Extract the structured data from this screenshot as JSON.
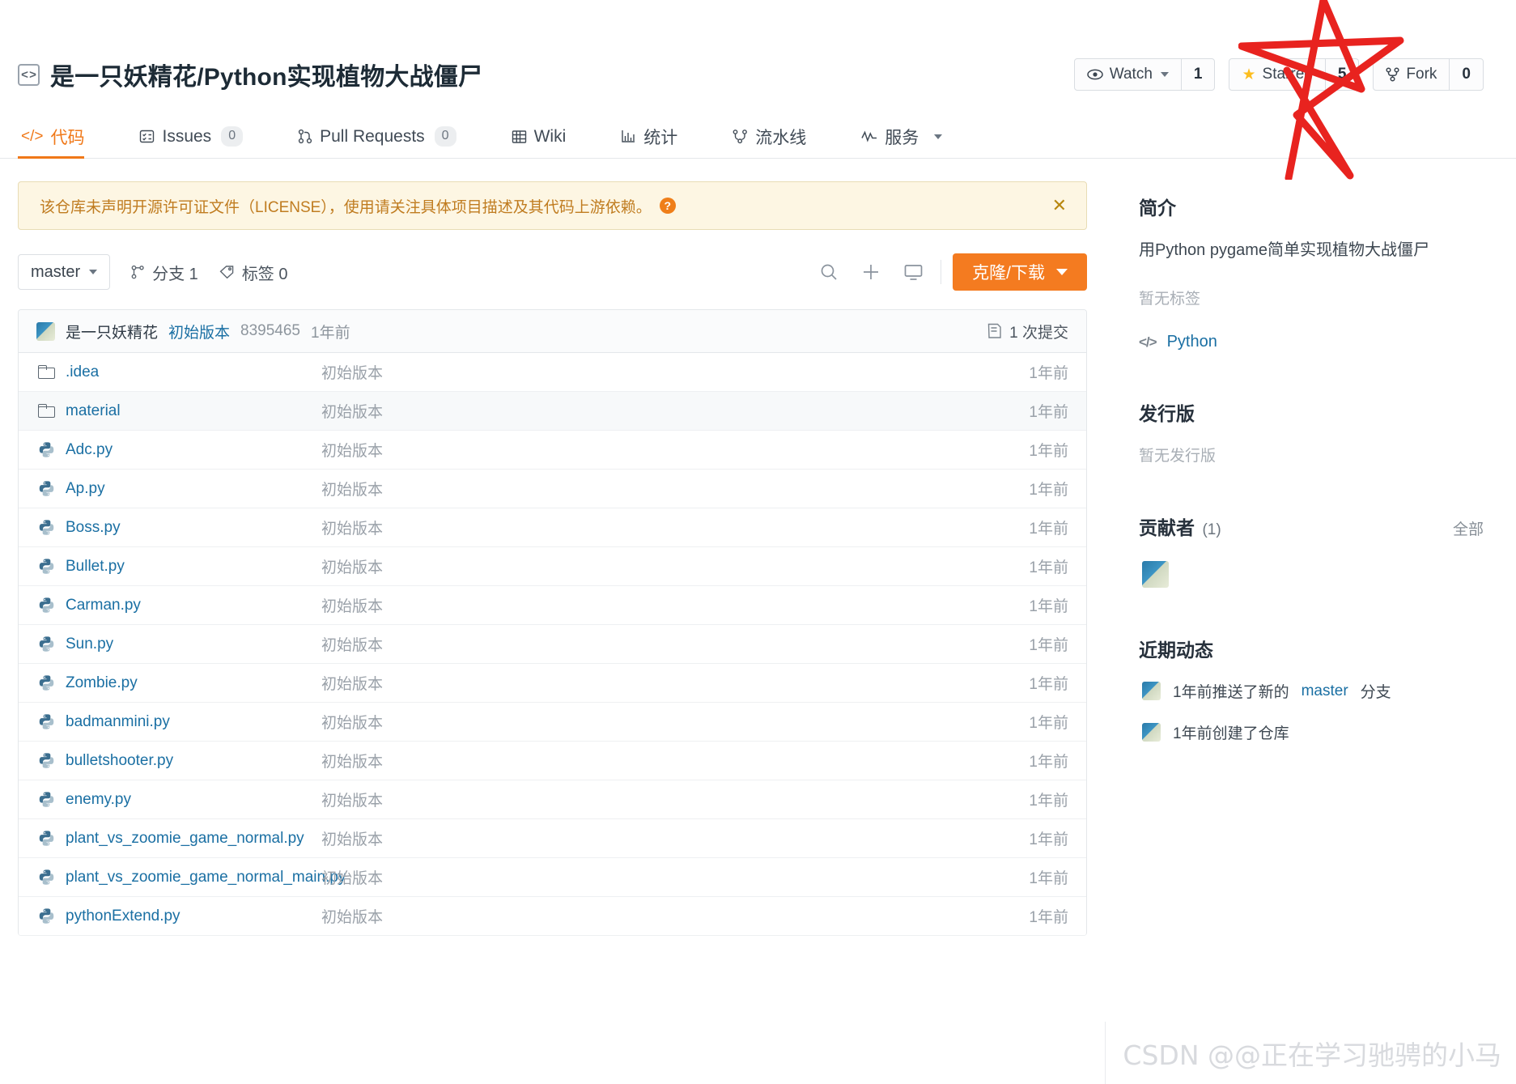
{
  "header": {
    "repo_icon": "code-brackets-icon",
    "repo_name": "是一只妖精花/Python实现植物大战僵尸",
    "actions": [
      {
        "id": "watch",
        "icon": "eye-icon",
        "label": "Watch",
        "has_caret": true,
        "count": "1"
      },
      {
        "id": "star",
        "icon": "star-icon",
        "label": "Starred",
        "has_caret": false,
        "count": "5"
      },
      {
        "id": "fork",
        "icon": "fork-icon",
        "label": "Fork",
        "has_caret": false,
        "count": "0"
      }
    ]
  },
  "nav": {
    "tabs": [
      {
        "id": "code",
        "icon": "code-icon",
        "label": "代码",
        "badge": null,
        "active": true,
        "caret": false
      },
      {
        "id": "issues",
        "icon": "issue-icon",
        "label": "Issues",
        "badge": "0",
        "active": false,
        "caret": false
      },
      {
        "id": "pulls",
        "icon": "pull-request-icon",
        "label": "Pull Requests",
        "badge": "0",
        "active": false,
        "caret": false
      },
      {
        "id": "wiki",
        "icon": "book-icon",
        "label": "Wiki",
        "badge": null,
        "active": false,
        "caret": false
      },
      {
        "id": "stats",
        "icon": "chart-icon",
        "label": "统计",
        "badge": null,
        "active": false,
        "caret": false
      },
      {
        "id": "pipeline",
        "icon": "pipeline-icon",
        "label": "流水线",
        "badge": null,
        "active": false,
        "caret": false
      },
      {
        "id": "service",
        "icon": "activity-icon",
        "label": "服务",
        "badge": null,
        "active": false,
        "caret": true
      }
    ]
  },
  "alert": {
    "text": "该仓库未声明开源许可证文件（LICENSE），使用请关注具体项目描述及其代码上游依赖。",
    "help_icon": "question-mark-icon",
    "close_icon": "close-icon"
  },
  "toolbar": {
    "branch": "master",
    "branch_caret_icon": "chevron-down-icon",
    "branches_icon": "branch-icon",
    "branches_label": "分支 1",
    "tags_icon": "tag-icon",
    "tags_label": "标签 0",
    "icons": [
      {
        "id": "search",
        "name": "search-icon"
      },
      {
        "id": "add",
        "name": "plus-icon"
      },
      {
        "id": "ide",
        "name": "monitor-icon"
      }
    ],
    "clone_label": "克隆/下载"
  },
  "commit_bar": {
    "avatar": "user-avatar",
    "author": "是一只妖精花",
    "message": "初始版本",
    "hash": "8395465",
    "time": "1年前",
    "commits_icon": "commit-icon",
    "commits_label": "1 次提交"
  },
  "files": [
    {
      "type": "folder",
      "name": ".idea",
      "message": "初始版本",
      "time": "1年前",
      "hovered": false
    },
    {
      "type": "folder",
      "name": "material",
      "message": "初始版本",
      "time": "1年前",
      "hovered": true
    },
    {
      "type": "python",
      "name": "Adc.py",
      "message": "初始版本",
      "time": "1年前",
      "hovered": false
    },
    {
      "type": "python",
      "name": "Ap.py",
      "message": "初始版本",
      "time": "1年前",
      "hovered": false
    },
    {
      "type": "python",
      "name": "Boss.py",
      "message": "初始版本",
      "time": "1年前",
      "hovered": false
    },
    {
      "type": "python",
      "name": "Bullet.py",
      "message": "初始版本",
      "time": "1年前",
      "hovered": false
    },
    {
      "type": "python",
      "name": "Carman.py",
      "message": "初始版本",
      "time": "1年前",
      "hovered": false
    },
    {
      "type": "python",
      "name": "Sun.py",
      "message": "初始版本",
      "time": "1年前",
      "hovered": false
    },
    {
      "type": "python",
      "name": "Zombie.py",
      "message": "初始版本",
      "time": "1年前",
      "hovered": false
    },
    {
      "type": "python",
      "name": "badmanmini.py",
      "message": "初始版本",
      "time": "1年前",
      "hovered": false
    },
    {
      "type": "python",
      "name": "bulletshooter.py",
      "message": "初始版本",
      "time": "1年前",
      "hovered": false
    },
    {
      "type": "python",
      "name": "enemy.py",
      "message": "初始版本",
      "time": "1年前",
      "hovered": false
    },
    {
      "type": "python",
      "name": "plant_vs_zoomie_game_normal.py",
      "message": "初始版本",
      "time": "1年前",
      "hovered": false
    },
    {
      "type": "python",
      "name": "plant_vs_zoomie_game_normal_main.py",
      "message": "初始版本",
      "time": "1年前",
      "hovered": false
    },
    {
      "type": "python",
      "name": "pythonExtend.py",
      "message": "初始版本",
      "time": "1年前",
      "hovered": false
    }
  ],
  "sidebar": {
    "intro_title": "简介",
    "intro_desc": "用Python pygame简单实现植物大战僵尸",
    "no_tags": "暂无标签",
    "lang_icon": "code-icon",
    "lang": "Python",
    "release_title": "发行版",
    "no_release": "暂无发行版",
    "contributors_title": "贡献者",
    "contributors_count": "(1)",
    "contributors_all": "全部",
    "contributors": [
      {
        "avatar": "user-avatar"
      }
    ],
    "activity_title": "近期动态",
    "activity": [
      {
        "avatar": "user-avatar",
        "prefix": "1年前推送了新的",
        "link": "master",
        "suffix": "分支"
      },
      {
        "avatar": "user-avatar",
        "prefix": "1年前创建了仓库",
        "link": "",
        "suffix": ""
      }
    ]
  },
  "watermark": "CSDN @@正在学习驰骋的小马",
  "annotation": {
    "shape": "hand-drawn-star",
    "color": "#e8231f"
  },
  "colors": {
    "accent_orange": "#f47b20",
    "link_blue": "#1a6fa3",
    "alert_bg": "#fdf6e3",
    "star_yellow": "#fcbd1f"
  }
}
